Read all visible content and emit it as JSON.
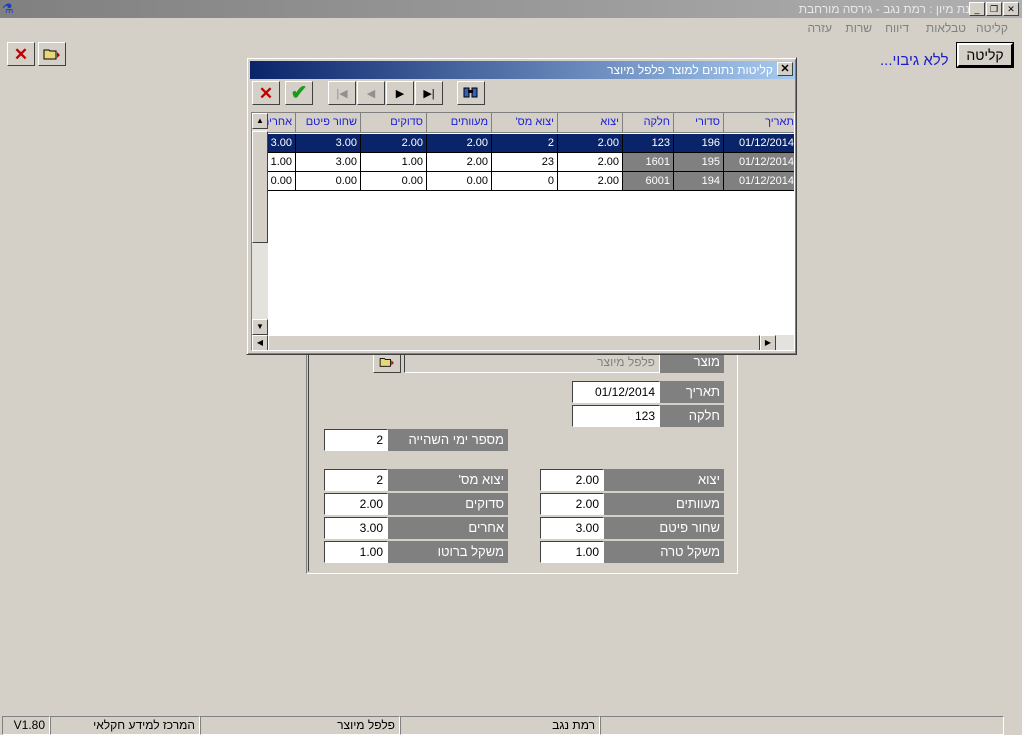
{
  "window": {
    "title": "תחנת מיון : רמת נגב - גירסה מורחבת",
    "minimize": "_",
    "restore": "❐",
    "close": "✕"
  },
  "menu": [
    "קליטה",
    "טבלאות",
    "דיווח",
    "שרות",
    "עזרה"
  ],
  "toolbar": {
    "close_icon": "close-icon",
    "open_icon": "folder-open-icon"
  },
  "header": {
    "kelita_button": "קליטה",
    "status_text": "ללא גיבוי..."
  },
  "dialog": {
    "title": "קליטות נתונים למוצר פלפל מיוצר",
    "close_label": "✕",
    "nav": [
      "|◀",
      "◀",
      "▶",
      "▶|"
    ],
    "columns": [
      "תאריך",
      "סדורי",
      "חלקה",
      "יצוא",
      "יצוא מס'",
      "מעוותים",
      "סדוקים",
      "שחור פיטם",
      "אחרים"
    ],
    "rows": [
      [
        "01/12/2014",
        "196",
        "123",
        "2.00",
        "2",
        "2.00",
        "2.00",
        "3.00",
        "3.00"
      ],
      [
        "01/12/2014",
        "195",
        "1601",
        "2.00",
        "23",
        "2.00",
        "1.00",
        "3.00",
        "1.00"
      ],
      [
        "01/12/2014",
        "194",
        "6001",
        "2.00",
        "0",
        "0.00",
        "0.00",
        "0.00",
        "0.00"
      ]
    ],
    "selected_row": 0
  },
  "form": {
    "product_label": "מוצר",
    "product_value": "פלפל מיוצר",
    "date_label": "תאריך",
    "date_value": "01/12/2014",
    "plot_label": "חלקה",
    "plot_value": "123",
    "storage_days_label": "מספר ימי השהייה",
    "storage_days_value": "2",
    "export_label": "יצוא",
    "export_value": "2.00",
    "export_num_label": "יצוא מס'",
    "export_num_value": "2",
    "distorted_label": "מעוותים",
    "distorted_value": "2.00",
    "cracked_label": "סדוקים",
    "cracked_value": "2.00",
    "black_tip_label": "שחור פיטם",
    "black_tip_value": "3.00",
    "others_label": "אחרים",
    "others_value": "3.00",
    "tare_label": "משקל טרה",
    "tare_value": "1.00",
    "gross_label": "משקל ברוטו",
    "gross_value": "1.00"
  },
  "status": {
    "site": "רמת נגב",
    "product": "פלפל מיוצר",
    "org": "המרכז למידע חקלאי",
    "version": "V1.80"
  }
}
